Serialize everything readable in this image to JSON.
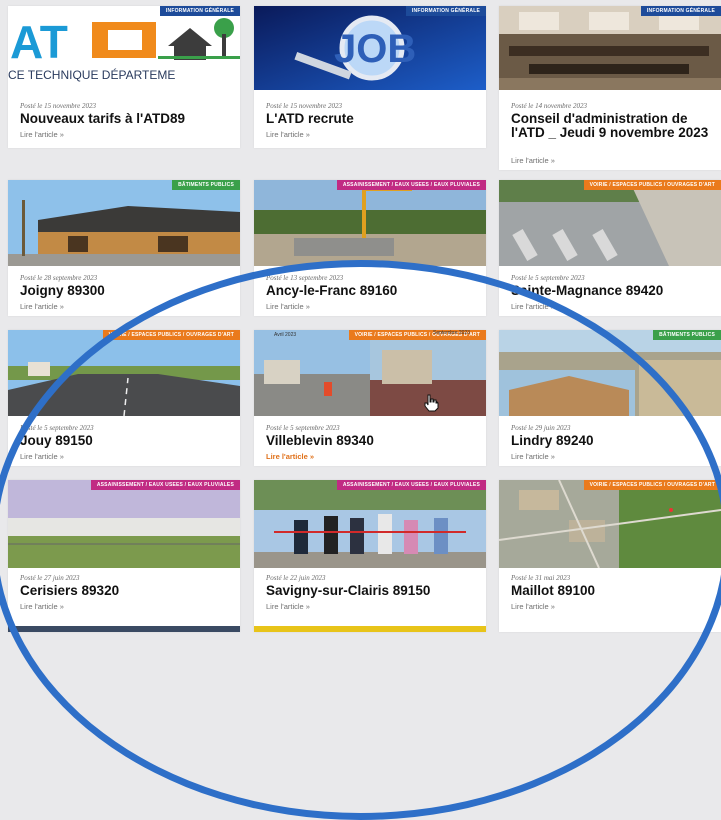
{
  "colors": {
    "tag_general": "#1d4b9a",
    "tag_green": "#3aa04a",
    "tag_magenta": "#c12b83",
    "tag_orange": "#ea7a1c",
    "frame": "#2e6fc8",
    "read_more_active": "#e0711a"
  },
  "read_more": "Lire l'article  »",
  "cards": [
    {
      "tag": "INFORMATION GÉNÉRALE",
      "date": "Posté le 15 novembre 2023",
      "title": "Nouveaux tarifs à l'ATD89",
      "thumb_text": "CE TECHNIQUE DÉPARTEME",
      "logo_text": "ATD"
    },
    {
      "tag": "INFORMATION GÉNÉRALE",
      "date": "Posté le 15 novembre 2023",
      "title": "L'ATD recrute",
      "thumb_text": "JOB"
    },
    {
      "tag": "INFORMATION GÉNÉRALE",
      "date": "Posté le 14 novembre 2023",
      "title": "Conseil d'administration de l'ATD _ Jeudi 9 novembre 2023"
    },
    {
      "tag": "BÂTIMENTS PUBLICS",
      "date": "Posté le 28 septembre 2023",
      "title": "Joigny 89300"
    },
    {
      "tag": "ASSAINISSEMENT / EAUX USEES / EAUX PLUVIALES",
      "date": "Posté le 13 septembre 2023",
      "title": "Ancy-le-Franc 89160"
    },
    {
      "tag": "VOIRIE / ESPACES PUBLICS / OUVRAGES D'ART",
      "date": "Posté le 5 septembre 2023",
      "title": "Sainte-Magnance 89420"
    },
    {
      "tag": "VOIRIE / ESPACES PUBLICS / OUVRAGES D'ART",
      "date": "Posté le 5 septembre 2023",
      "title": "Jouy 89150"
    },
    {
      "tag": "VOIRIE / ESPACES PUBLICS / OUVRAGES D'ART",
      "date": "Posté le 5 septembre 2023",
      "title": "Villeblevin 89340",
      "corner_left": "Avril 2023",
      "corner_right": "Septembre 2023"
    },
    {
      "tag": "BÂTIMENTS PUBLICS",
      "date": "Posté le 29 juin 2023",
      "title": "Lindry 89240"
    },
    {
      "tag": "ASSAINISSEMENT / EAUX USEES / EAUX PLUVIALES",
      "date": "Posté le 27 juin 2023",
      "title": "Cerisiers 89320"
    },
    {
      "tag": "ASSAINISSEMENT / EAUX USEES / EAUX PLUVIALES",
      "date": "Posté le 22 juin 2023",
      "title": "Savigny-sur-Clairis 89150"
    },
    {
      "tag": "VOIRIE / ESPACES PUBLICS / OUVRAGES D'ART",
      "date": "Posté le 31 mai 2023",
      "title": "Maillot 89100"
    }
  ]
}
